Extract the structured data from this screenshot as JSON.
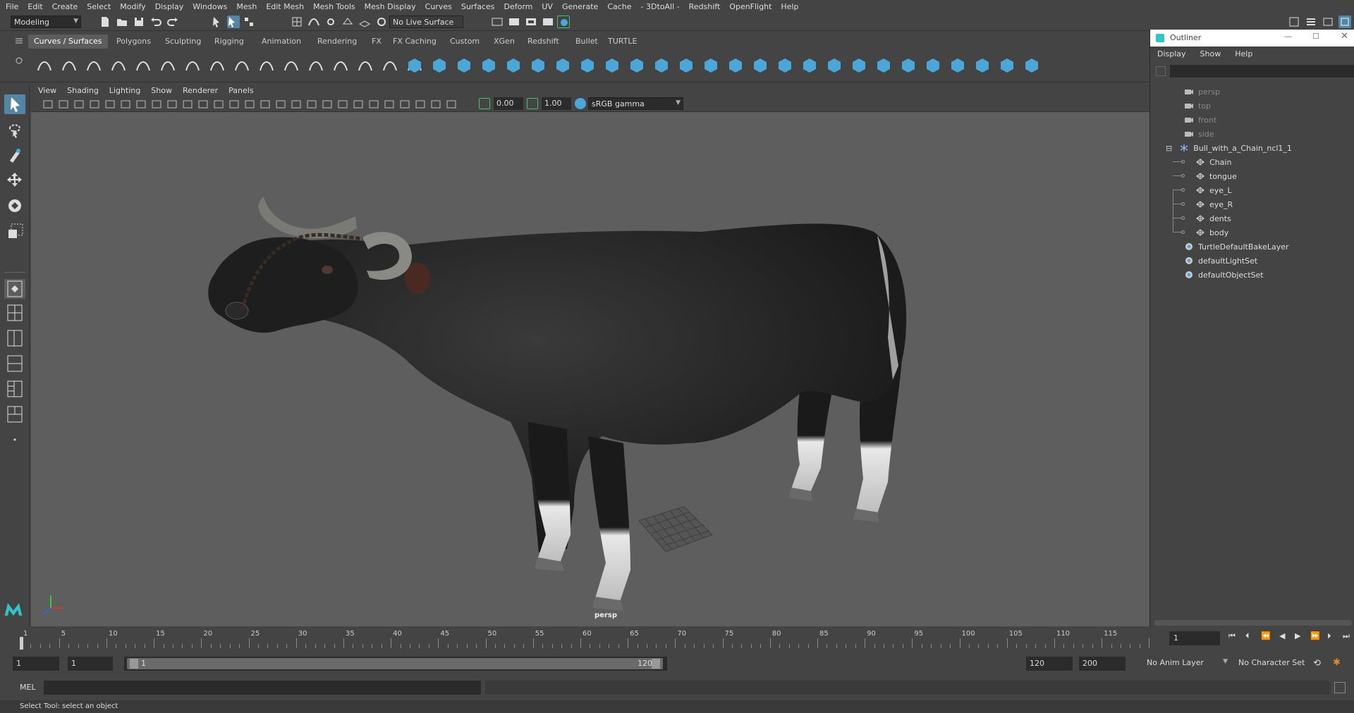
{
  "menubar": [
    "File",
    "Edit",
    "Create",
    "Select",
    "Modify",
    "Display",
    "Windows",
    "Mesh",
    "Edit Mesh",
    "Mesh Tools",
    "Mesh Display",
    "Curves",
    "Surfaces",
    "Deform",
    "UV",
    "Generate",
    "Cache",
    "- 3DtoAll -",
    "Redshift",
    "OpenFlight",
    "Help"
  ],
  "status": {
    "mode": "Modeling",
    "live_surface": "No Live Surface"
  },
  "shelf_tabs": [
    "Curves / Surfaces",
    "Polygons",
    "Sculpting",
    "Rigging",
    "Animation",
    "Rendering",
    "FX",
    "FX Caching",
    "Custom",
    "XGen",
    "Redshift",
    "Bullet",
    "TURTLE"
  ],
  "shelf_active": "Curves / Surfaces",
  "panel_menu": [
    "View",
    "Shading",
    "Lighting",
    "Show",
    "Renderer",
    "Panels"
  ],
  "panel_toolbar": {
    "exposure": "0.00",
    "gamma": "1.00",
    "color_space": "sRGB gamma"
  },
  "viewport": {
    "camera_label": "persp"
  },
  "outliner": {
    "title": "Outliner",
    "menu": [
      "Display",
      "Show",
      "Help"
    ],
    "cameras": [
      "persp",
      "top",
      "front",
      "side"
    ],
    "group": "Bull_with_a_Chain_ncl1_1",
    "children": [
      "Chain",
      "tongue",
      "eye_L",
      "eye_R",
      "dents",
      "body"
    ],
    "sets": [
      "TurtleDefaultBakeLayer",
      "defaultLightSet",
      "defaultObjectSet"
    ]
  },
  "timeline": {
    "ticks": [
      "1",
      "5",
      "10",
      "15",
      "20",
      "25",
      "30",
      "35",
      "40",
      "45",
      "50",
      "55",
      "60",
      "65",
      "70",
      "75",
      "80",
      "85",
      "90",
      "95",
      "100",
      "105",
      "110",
      "115"
    ],
    "current_frame": "1"
  },
  "range": {
    "start_field": "1",
    "start_field2": "1",
    "slider_start": "1",
    "slider_end": "120",
    "end_field": "120",
    "end_field2": "200",
    "anim_layer": "No Anim Layer",
    "character_set": "No Character Set"
  },
  "cmd": {
    "label": "MEL"
  },
  "help_line": "Select Tool: select an object",
  "colors": {
    "accent": "#5285a6",
    "bg": "#444444",
    "viewport": "#5e5e5e",
    "shelf_icon": "#4aa7d8"
  }
}
